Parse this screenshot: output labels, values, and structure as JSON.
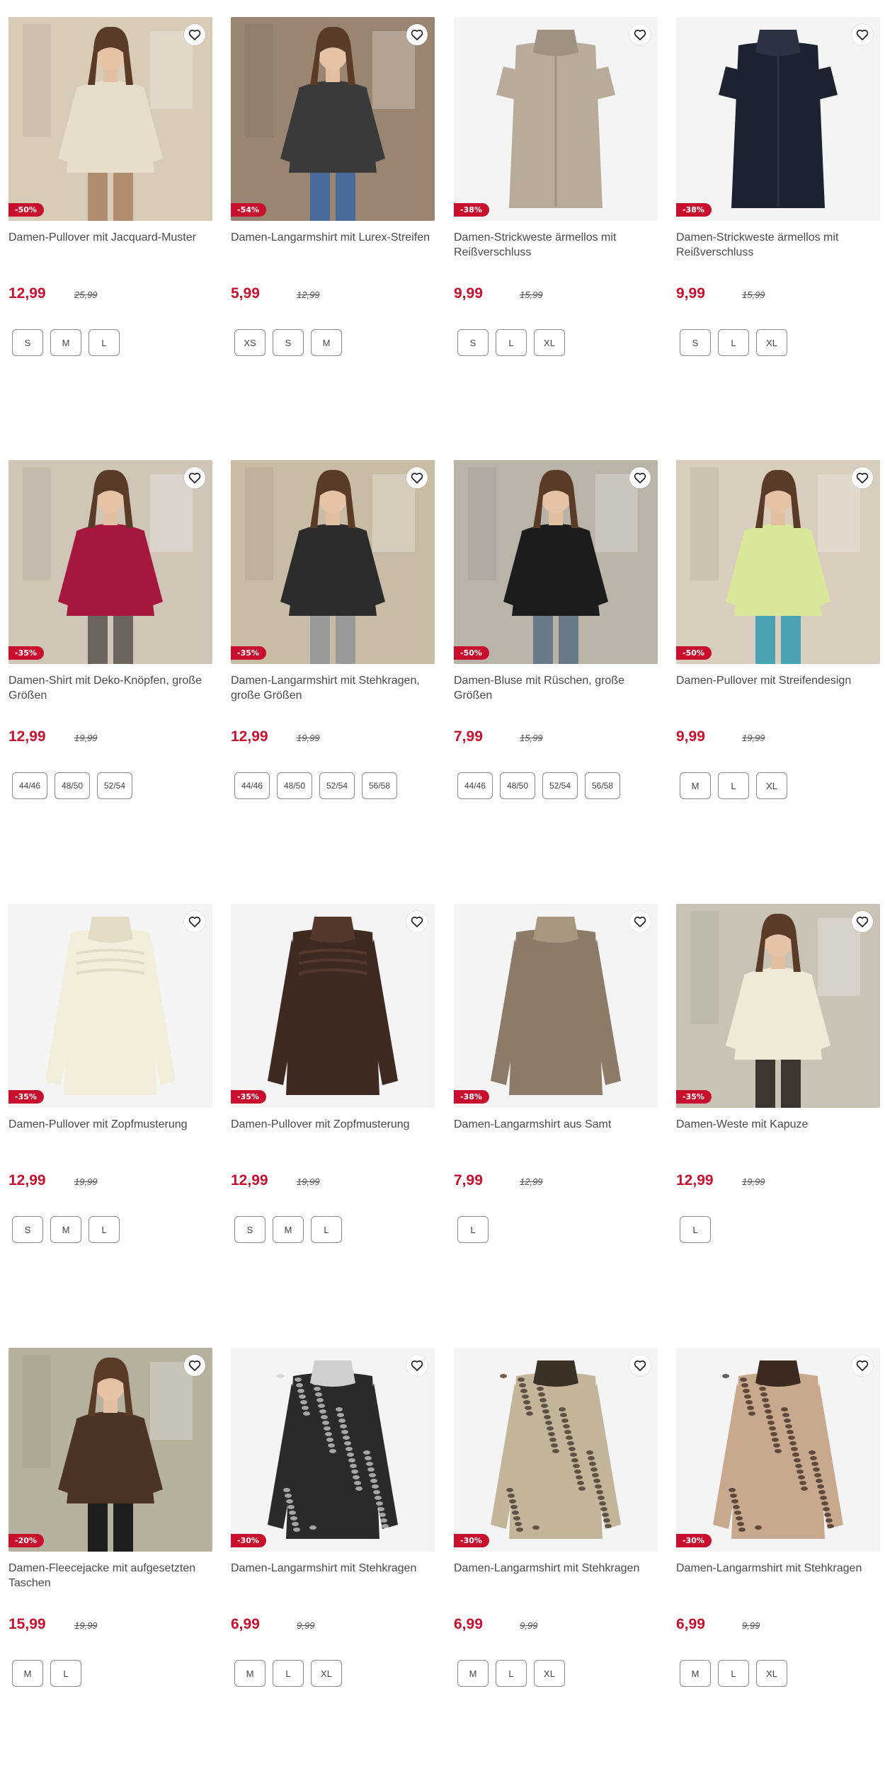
{
  "products": [
    {
      "title": "Damen-Pullover mit Jacquard-Muster",
      "price": "12,99",
      "old_price": "25,99",
      "discount": "-50%",
      "sizes": [
        "S",
        "M",
        "L"
      ],
      "image": "model-beige-jacquard-sweater",
      "colors": {
        "bg": "#d8cbb8",
        "garment": "#e8dccb",
        "accent": "#b08e6d"
      }
    },
    {
      "title": "Damen-Langarmshirt mit Lurex-Streifen",
      "price": "5,99",
      "old_price": "12,99",
      "discount": "-54%",
      "sizes": [
        "XS",
        "S",
        "M"
      ],
      "image": "model-black-ruched-top",
      "colors": {
        "bg": "#9a8572",
        "garment": "#3a3a3a",
        "accent": "#4a6a9a"
      }
    },
    {
      "title": "Damen-Strickweste ärmellos mit Reißverschluss",
      "price": "9,99",
      "old_price": "15,99",
      "discount": "-38%",
      "sizes": [
        "S",
        "L",
        "XL"
      ],
      "image": "product-beige-knit-vest",
      "colors": {
        "bg": "#f4f4f4",
        "garment": "#b9ab9a",
        "accent": "#a09282"
      }
    },
    {
      "title": "Damen-Strickweste ärmellos mit Reißverschluss",
      "price": "9,99",
      "old_price": "15,99",
      "discount": "-38%",
      "sizes": [
        "S",
        "L",
        "XL"
      ],
      "image": "product-navy-knit-vest",
      "colors": {
        "bg": "#f4f4f4",
        "garment": "#1c2230",
        "accent": "#2c3242"
      }
    },
    {
      "title": "Damen-Shirt mit Deko-Knöpfen, große Größen",
      "price": "12,99",
      "old_price": "19,99",
      "discount": "-35%",
      "sizes": [
        "44/46",
        "48/50",
        "52/54"
      ],
      "image": "model-burgundy-shirt",
      "colors": {
        "bg": "#cfc6b8",
        "garment": "#a5173c",
        "accent": "#6d6560"
      }
    },
    {
      "title": "Damen-Langarmshirt mit Stehkragen, große Größen",
      "price": "12,99",
      "old_price": "19,99",
      "discount": "-35%",
      "sizes": [
        "44/46",
        "48/50",
        "52/54",
        "56/58"
      ],
      "image": "model-black-printed-shirt",
      "colors": {
        "bg": "#c9bca6",
        "garment": "#2c2c2c",
        "accent": "#9a9a9a"
      }
    },
    {
      "title": "Damen-Bluse mit Rüschen, große Größen",
      "price": "7,99",
      "old_price": "15,99",
      "discount": "-50%",
      "sizes": [
        "44/46",
        "48/50",
        "52/54",
        "56/58"
      ],
      "image": "model-black-ruffle-blouse",
      "colors": {
        "bg": "#b9b3a8",
        "garment": "#1c1c1c",
        "accent": "#6b7a88"
      }
    },
    {
      "title": "Damen-Pullover mit Streifendesign",
      "price": "9,99",
      "old_price": "19,99",
      "discount": "-50%",
      "sizes": [
        "M",
        "L",
        "XL"
      ],
      "image": "model-lime-striped-sweater",
      "colors": {
        "bg": "#d9cdbd",
        "garment": "#d8e79a",
        "accent": "#4aa3b5"
      }
    },
    {
      "title": "Damen-Pullover mit Zopfmusterung",
      "price": "12,99",
      "old_price": "19,99",
      "discount": "-35%",
      "sizes": [
        "S",
        "M",
        "L"
      ],
      "image": "product-cream-cable-sweater",
      "colors": {
        "bg": "#f4f4f4",
        "garment": "#f3eedc",
        "accent": "#e2dcc6"
      }
    },
    {
      "title": "Damen-Pullover mit Zopfmusterung",
      "price": "12,99",
      "old_price": "19,99",
      "discount": "-35%",
      "sizes": [
        "S",
        "M",
        "L"
      ],
      "image": "product-brown-cable-sweater",
      "colors": {
        "bg": "#f4f4f4",
        "garment": "#3f2a22",
        "accent": "#54382d"
      }
    },
    {
      "title": "Damen-Langarmshirt aus Samt",
      "price": "7,99",
      "old_price": "12,99",
      "discount": "-38%",
      "sizes": [
        "L"
      ],
      "image": "product-taupe-velvet-shirt",
      "colors": {
        "bg": "#f4f4f4",
        "garment": "#8c7b68",
        "accent": "#a8977f"
      }
    },
    {
      "title": "Damen-Weste mit Kapuze",
      "price": "12,99",
      "old_price": "19,99",
      "discount": "-35%",
      "sizes": [
        "L"
      ],
      "image": "model-cream-hooded-vest",
      "colors": {
        "bg": "#c8c3b5",
        "garment": "#efe9d8",
        "accent": "#3c3530"
      }
    },
    {
      "title": "Damen-Fleecejacke mit aufgesetzten Taschen",
      "price": "15,99",
      "old_price": "19,99",
      "discount": "-20%",
      "sizes": [
        "M",
        "L"
      ],
      "image": "model-brown-fleece-jacket",
      "colors": {
        "bg": "#b6b09f",
        "garment": "#4b3426",
        "accent": "#1e1e1e"
      }
    },
    {
      "title": "Damen-Langarmshirt mit Stehkragen",
      "price": "6,99",
      "old_price": "9,99",
      "discount": "-30%",
      "sizes": [
        "M",
        "L",
        "XL"
      ],
      "image": "product-black-white-print-shirt",
      "colors": {
        "bg": "#f4f4f4",
        "garment": "#2a2a2a",
        "accent": "#cfcfcf"
      }
    },
    {
      "title": "Damen-Langarmshirt mit Stehkragen",
      "price": "6,99",
      "old_price": "9,99",
      "discount": "-30%",
      "sizes": [
        "M",
        "L",
        "XL"
      ],
      "image": "product-leopard-print-shirt",
      "colors": {
        "bg": "#f4f4f4",
        "garment": "#c2b59a",
        "accent": "#3b3226"
      }
    },
    {
      "title": "Damen-Langarmshirt mit Stehkragen",
      "price": "6,99",
      "old_price": "9,99",
      "discount": "-30%",
      "sizes": [
        "M",
        "L",
        "XL"
      ],
      "image": "product-zebra-print-shirt",
      "colors": {
        "bg": "#f4f4f4",
        "garment": "#c9a98e",
        "accent": "#3a2a20"
      }
    }
  ],
  "ui": {
    "favorite_icon": "heart-outline-icon",
    "sale_color": "#c8102e"
  }
}
